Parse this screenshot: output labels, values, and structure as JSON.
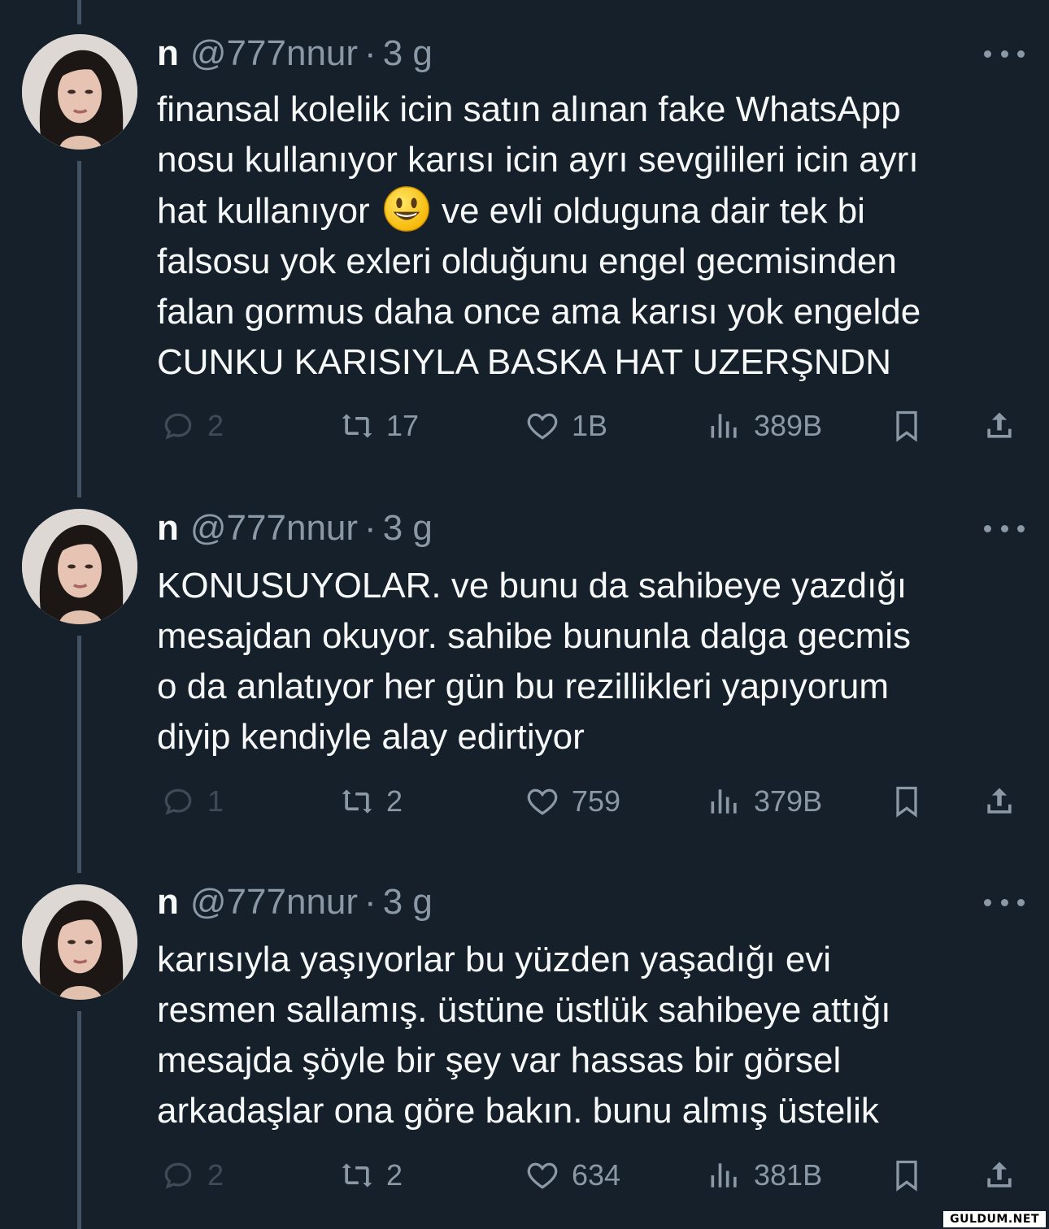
{
  "tweets": [
    {
      "name": "n",
      "handle": "@777nnur",
      "separator": "·",
      "time": "3 g",
      "lines_before_emoji": [
        "finansal kolelik icin satın alınan fake WhatsApp",
        "nosu kullanıyor karısı icin ayrı sevgilileri icin ayrı"
      ],
      "emoji_line_start": "hat kullanıyor",
      "emoji_line_end": "ve evli olduguna dair tek bi",
      "lines_after_emoji": [
        "falsosu yok exleri olduğunu engel gecmisinden",
        "falan gormus daha once ama karısı yok engelde",
        "CUNKU KARISIYLA BASKA HAT UZERŞNDN"
      ],
      "replies": "2",
      "retweets": "17",
      "likes": "1B",
      "views": "389B"
    },
    {
      "name": "n",
      "handle": "@777nnur",
      "separator": "·",
      "time": "3 g",
      "lines": [
        "KONUSUYOLAR. ve bunu da sahibeye yazdığı",
        "mesajdan okuyor. sahibe bununla dalga gecmis",
        "o da anlatıyor her gün bu rezillikleri yapıyorum",
        "diyip kendiyle alay edirtiyor"
      ],
      "replies": "1",
      "retweets": "2",
      "likes": "759",
      "views": "379B"
    },
    {
      "name": "n",
      "handle": "@777nnur",
      "separator": "·",
      "time": "3 g",
      "lines": [
        "karısıyla yaşıyorlar bu yüzden yaşadığı evi",
        "resmen sallamış. üstüne üstlük sahibeye attığı",
        "mesajda şöyle bir şey var hassas bir görsel",
        "arkadaşlar ona göre bakın. bunu almış üstelik"
      ],
      "replies": "2",
      "retweets": "2",
      "likes": "634",
      "views": "381B"
    }
  ],
  "watermark": "GULDUM.NET",
  "colors": {
    "background": "#15202b",
    "text": "#f7f9f9",
    "secondary": "#8b98a5",
    "thread_line": "#425364"
  },
  "icons": [
    "reply-icon",
    "retweet-icon",
    "like-icon",
    "views-icon",
    "bookmark-icon",
    "share-icon",
    "more-icon",
    "smiley-emoji"
  ]
}
